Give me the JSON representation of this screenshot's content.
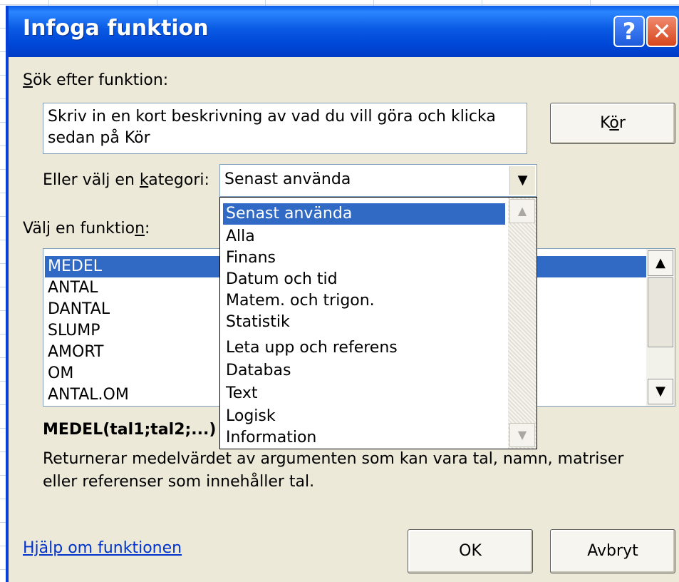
{
  "window": {
    "title": "Infoga funktion"
  },
  "titlebar": {
    "help_icon": "?",
    "close_icon": "✕"
  },
  "search": {
    "label_prefix": "S",
    "label_rest": "ök efter funktion:",
    "text_line1": "Skriv in en kort beskrivning av vad du vill göra och klicka",
    "text_line2": "sedan på Kör",
    "run_button_pre": "K",
    "run_button_u": "ö",
    "run_button_post": "r"
  },
  "category": {
    "label_pre": "Eller välj en ",
    "label_u": "k",
    "label_post": "ategori:",
    "selected": "Senast använda",
    "options": [
      "Senast använda",
      "Alla",
      "Finans",
      "Datum och tid",
      "Matem. och trigon.",
      "Statistik",
      "Leta upp och referens",
      "Databas",
      "Text",
      "Logisk",
      "Information"
    ]
  },
  "functions": {
    "label_pre": "Välj en funktio",
    "label_u": "n",
    "label_post": ":",
    "items": [
      "MEDEL",
      "ANTAL",
      "DANTAL",
      "SLUMP",
      "AMORT",
      "OM",
      "ANTAL.OM"
    ],
    "selected": "MEDEL"
  },
  "details": {
    "signature": "MEDEL(tal1;tal2;...)",
    "description_line1": "Returnerar medelvärdet av argumenten som kan vara tal, namn, matriser",
    "description_line2": "eller referenser som innehåller tal."
  },
  "footer": {
    "help_link": "Hjälp om funktionen",
    "ok_label": "OK",
    "cancel_label": "Avbryt"
  },
  "colors": {
    "titlebar": "#0a5ae3",
    "dialog_bg": "#ece9d8",
    "selection": "#316ac5",
    "link": "#0033cc"
  }
}
